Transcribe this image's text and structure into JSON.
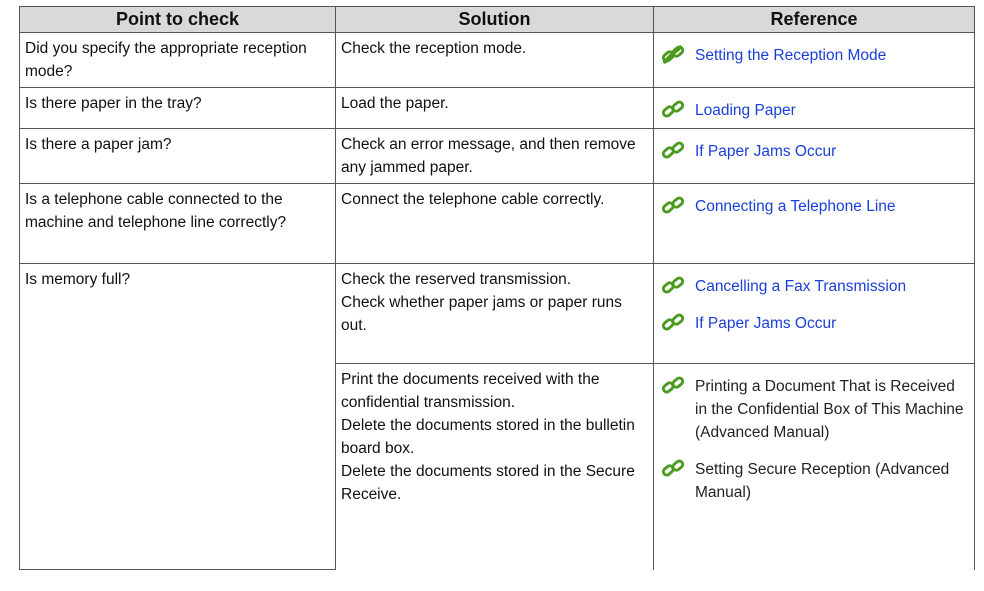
{
  "table": {
    "headers": [
      "Point to check",
      "Solution",
      "Reference"
    ],
    "rows": [
      {
        "point": "Did you specify the appropriate reception mode?",
        "solution": [
          "Check the reception mode."
        ],
        "refs": [
          {
            "text": "Setting the Reception Mode",
            "link": true
          }
        ]
      },
      {
        "point": "Is there paper in the tray?",
        "solution": [
          "Load the paper."
        ],
        "refs": [
          {
            "text": "Loading Paper",
            "link": true
          }
        ]
      },
      {
        "point": "Is there a paper jam?",
        "solution": [
          "Check an error message, and then remove any jammed paper."
        ],
        "refs": [
          {
            "text": "If Paper Jams Occur",
            "link": true
          }
        ]
      },
      {
        "point": "Is a telephone cable connected to the machine and telephone line correctly?",
        "solution": [
          "Connect the telephone cable correctly."
        ],
        "refs": [
          {
            "text": "Connecting a Telephone Line",
            "link": true
          }
        ]
      },
      {
        "point": "Is memory full?",
        "solution": [
          "Check the reserved transmission.",
          "Check whether paper jams or paper runs out."
        ],
        "refs": [
          {
            "text": "Cancelling a Fax Transmission",
            "link": true
          },
          {
            "text": "If Paper Jams Occur",
            "link": true
          }
        ]
      },
      {
        "solution": [
          "Print the documents received with the confidential transmission.",
          "Delete the documents stored in the bulletin board box.",
          "Delete the documents stored in the Secure Receive."
        ],
        "refs": [
          {
            "text": "Printing a Document That is Received in the Confidential Box of This Machine (Advanced Manual)",
            "link": false
          },
          {
            "text": "Setting Secure Reception (Advanced Manual)",
            "link": false
          }
        ]
      }
    ]
  },
  "icons": {
    "reference": "chain-link-icon",
    "color": "#4a9a1e"
  }
}
